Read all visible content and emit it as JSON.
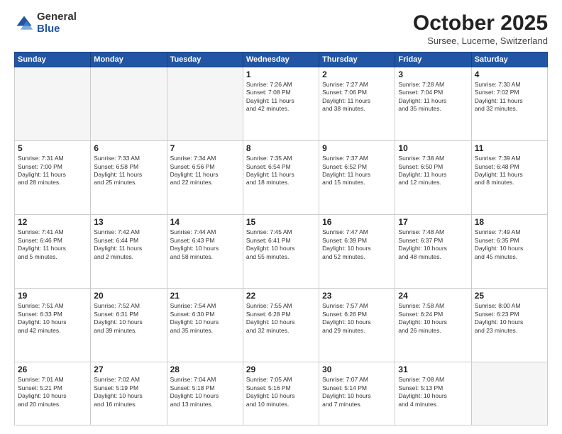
{
  "logo": {
    "general": "General",
    "blue": "Blue"
  },
  "header": {
    "month": "October 2025",
    "location": "Sursee, Lucerne, Switzerland"
  },
  "weekdays": [
    "Sunday",
    "Monday",
    "Tuesday",
    "Wednesday",
    "Thursday",
    "Friday",
    "Saturday"
  ],
  "weeks": [
    [
      {
        "day": "",
        "info": ""
      },
      {
        "day": "",
        "info": ""
      },
      {
        "day": "",
        "info": ""
      },
      {
        "day": "1",
        "info": "Sunrise: 7:26 AM\nSunset: 7:08 PM\nDaylight: 11 hours\nand 42 minutes."
      },
      {
        "day": "2",
        "info": "Sunrise: 7:27 AM\nSunset: 7:06 PM\nDaylight: 11 hours\nand 38 minutes."
      },
      {
        "day": "3",
        "info": "Sunrise: 7:28 AM\nSunset: 7:04 PM\nDaylight: 11 hours\nand 35 minutes."
      },
      {
        "day": "4",
        "info": "Sunrise: 7:30 AM\nSunset: 7:02 PM\nDaylight: 11 hours\nand 32 minutes."
      }
    ],
    [
      {
        "day": "5",
        "info": "Sunrise: 7:31 AM\nSunset: 7:00 PM\nDaylight: 11 hours\nand 28 minutes."
      },
      {
        "day": "6",
        "info": "Sunrise: 7:33 AM\nSunset: 6:58 PM\nDaylight: 11 hours\nand 25 minutes."
      },
      {
        "day": "7",
        "info": "Sunrise: 7:34 AM\nSunset: 6:56 PM\nDaylight: 11 hours\nand 22 minutes."
      },
      {
        "day": "8",
        "info": "Sunrise: 7:35 AM\nSunset: 6:54 PM\nDaylight: 11 hours\nand 18 minutes."
      },
      {
        "day": "9",
        "info": "Sunrise: 7:37 AM\nSunset: 6:52 PM\nDaylight: 11 hours\nand 15 minutes."
      },
      {
        "day": "10",
        "info": "Sunrise: 7:38 AM\nSunset: 6:50 PM\nDaylight: 11 hours\nand 12 minutes."
      },
      {
        "day": "11",
        "info": "Sunrise: 7:39 AM\nSunset: 6:48 PM\nDaylight: 11 hours\nand 8 minutes."
      }
    ],
    [
      {
        "day": "12",
        "info": "Sunrise: 7:41 AM\nSunset: 6:46 PM\nDaylight: 11 hours\nand 5 minutes."
      },
      {
        "day": "13",
        "info": "Sunrise: 7:42 AM\nSunset: 6:44 PM\nDaylight: 11 hours\nand 2 minutes."
      },
      {
        "day": "14",
        "info": "Sunrise: 7:44 AM\nSunset: 6:43 PM\nDaylight: 10 hours\nand 58 minutes."
      },
      {
        "day": "15",
        "info": "Sunrise: 7:45 AM\nSunset: 6:41 PM\nDaylight: 10 hours\nand 55 minutes."
      },
      {
        "day": "16",
        "info": "Sunrise: 7:47 AM\nSunset: 6:39 PM\nDaylight: 10 hours\nand 52 minutes."
      },
      {
        "day": "17",
        "info": "Sunrise: 7:48 AM\nSunset: 6:37 PM\nDaylight: 10 hours\nand 48 minutes."
      },
      {
        "day": "18",
        "info": "Sunrise: 7:49 AM\nSunset: 6:35 PM\nDaylight: 10 hours\nand 45 minutes."
      }
    ],
    [
      {
        "day": "19",
        "info": "Sunrise: 7:51 AM\nSunset: 6:33 PM\nDaylight: 10 hours\nand 42 minutes."
      },
      {
        "day": "20",
        "info": "Sunrise: 7:52 AM\nSunset: 6:31 PM\nDaylight: 10 hours\nand 39 minutes."
      },
      {
        "day": "21",
        "info": "Sunrise: 7:54 AM\nSunset: 6:30 PM\nDaylight: 10 hours\nand 35 minutes."
      },
      {
        "day": "22",
        "info": "Sunrise: 7:55 AM\nSunset: 6:28 PM\nDaylight: 10 hours\nand 32 minutes."
      },
      {
        "day": "23",
        "info": "Sunrise: 7:57 AM\nSunset: 6:26 PM\nDaylight: 10 hours\nand 29 minutes."
      },
      {
        "day": "24",
        "info": "Sunrise: 7:58 AM\nSunset: 6:24 PM\nDaylight: 10 hours\nand 26 minutes."
      },
      {
        "day": "25",
        "info": "Sunrise: 8:00 AM\nSunset: 6:23 PM\nDaylight: 10 hours\nand 23 minutes."
      }
    ],
    [
      {
        "day": "26",
        "info": "Sunrise: 7:01 AM\nSunset: 5:21 PM\nDaylight: 10 hours\nand 20 minutes."
      },
      {
        "day": "27",
        "info": "Sunrise: 7:02 AM\nSunset: 5:19 PM\nDaylight: 10 hours\nand 16 minutes."
      },
      {
        "day": "28",
        "info": "Sunrise: 7:04 AM\nSunset: 5:18 PM\nDaylight: 10 hours\nand 13 minutes."
      },
      {
        "day": "29",
        "info": "Sunrise: 7:05 AM\nSunset: 5:16 PM\nDaylight: 10 hours\nand 10 minutes."
      },
      {
        "day": "30",
        "info": "Sunrise: 7:07 AM\nSunset: 5:14 PM\nDaylight: 10 hours\nand 7 minutes."
      },
      {
        "day": "31",
        "info": "Sunrise: 7:08 AM\nSunset: 5:13 PM\nDaylight: 10 hours\nand 4 minutes."
      },
      {
        "day": "",
        "info": ""
      }
    ]
  ]
}
